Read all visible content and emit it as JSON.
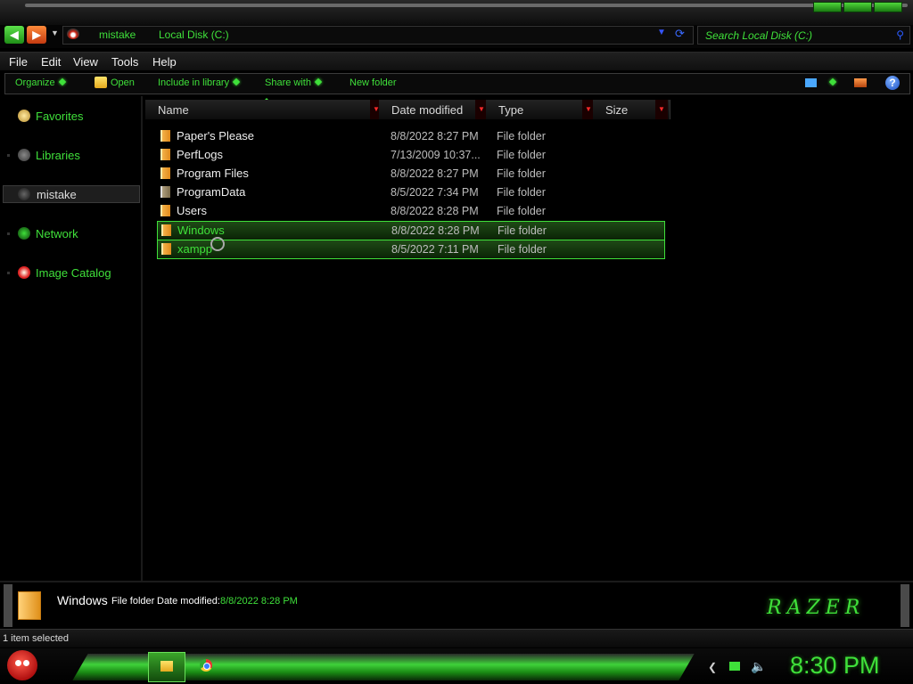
{
  "address_bar": {
    "breadcrumbs": [
      "mistake",
      "Local Disk (C:)"
    ]
  },
  "search": {
    "placeholder": "Search Local Disk (C:)"
  },
  "menu": [
    "File",
    "Edit",
    "View",
    "Tools",
    "Help"
  ],
  "command_bar": {
    "organize": "Organize",
    "open": "Open",
    "include_in_library": "Include in library",
    "share_with": "Share with",
    "new_folder": "New folder"
  },
  "sidebar": {
    "items": [
      {
        "label": "Favorites",
        "icon": "star-icon"
      },
      {
        "label": "Libraries",
        "icon": "libraries-icon"
      },
      {
        "label": "mistake",
        "icon": "user-icon"
      },
      {
        "label": "Network",
        "icon": "network-icon"
      },
      {
        "label": "Image Catalog",
        "icon": "image-catalog-icon"
      }
    ]
  },
  "columns": [
    "Name",
    "Date modified",
    "Type",
    "Size"
  ],
  "files": [
    {
      "name": "Paper's Please",
      "date": "8/8/2022 8:27 PM",
      "type": "File folder"
    },
    {
      "name": "PerfLogs",
      "date": "7/13/2009 10:37...",
      "type": "File folder"
    },
    {
      "name": "Program Files",
      "date": "8/8/2022 8:27 PM",
      "type": "File folder"
    },
    {
      "name": "ProgramData",
      "date": "8/5/2022 7:34 PM",
      "type": "File folder"
    },
    {
      "name": "Users",
      "date": "8/8/2022 8:28 PM",
      "type": "File folder"
    },
    {
      "name": "Windows",
      "date": "8/8/2022 8:28 PM",
      "type": "File folder",
      "selected": true
    },
    {
      "name": "xampp",
      "date": "8/5/2022 7:11 PM",
      "type": "File folder",
      "selected": true
    }
  ],
  "details": {
    "name": "Windows",
    "type": "File folder",
    "modified_label": "Date modified:",
    "modified_value": "8/8/2022 8:28 PM",
    "brand": "RAZER"
  },
  "status": {
    "text": "1 item selected"
  },
  "taskbar": {
    "clock": "8:30 PM"
  },
  "colors": {
    "accent": "#3fe03a",
    "dropdown_marker": "#ff2a2a",
    "background": "#000000"
  }
}
